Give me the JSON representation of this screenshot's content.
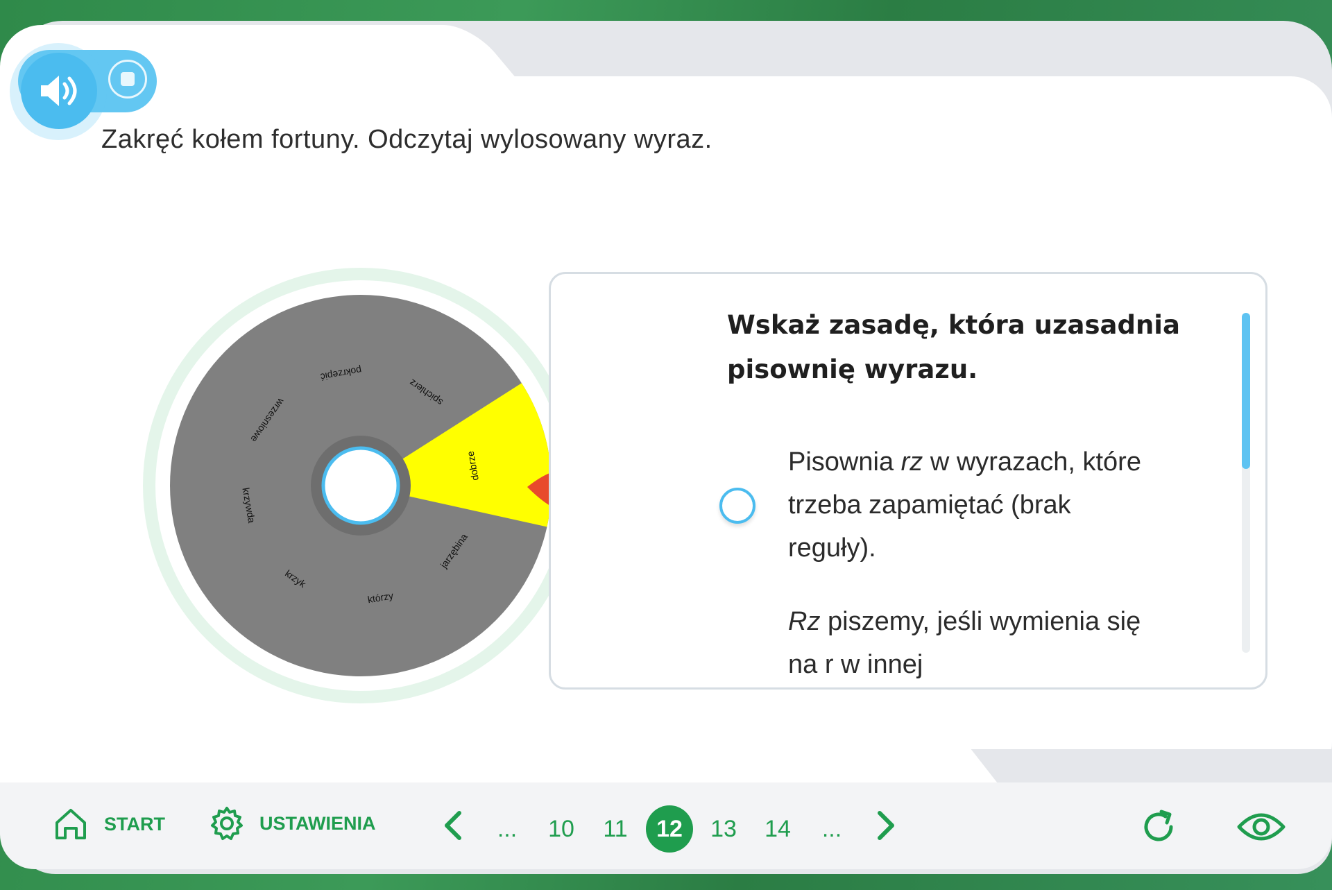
{
  "instruction": "Zakręć kołem fortuny. Odczytaj wylosowany wyraz.",
  "audio": {
    "icon": "speaker-icon",
    "stop_icon": "stop-icon"
  },
  "wheel": {
    "words": [
      "dobrze",
      "spichlerz",
      "pokrzepić",
      "wrzesniowe",
      "krzywda",
      "krzyk",
      "którzy",
      "jarzębina"
    ],
    "selected": "dobrze",
    "colors": {
      "segment": "#808080",
      "selected": "#ffff00",
      "pointer": "#e84a2c",
      "ring": "#e4f5ea"
    }
  },
  "panel": {
    "question": "Wskaż zasadę, która uzasadnia pisownię wyrazu.",
    "answer1_parts": [
      "Pisownia ",
      "rz",
      " w wyrazach, które trzeba zapamiętać (brak reguły)."
    ],
    "answer2_parts": [
      "Rz",
      " piszemy, jeśli wymienia się na r w innej"
    ]
  },
  "footer": {
    "start_label": "START",
    "settings_label": "USTAWIENIA",
    "pages": [
      "...",
      "10",
      "11",
      "12",
      "13",
      "14",
      "..."
    ],
    "active_page": "12"
  },
  "colors": {
    "accent": "#1f9d4e",
    "blue": "#4bbcef"
  }
}
